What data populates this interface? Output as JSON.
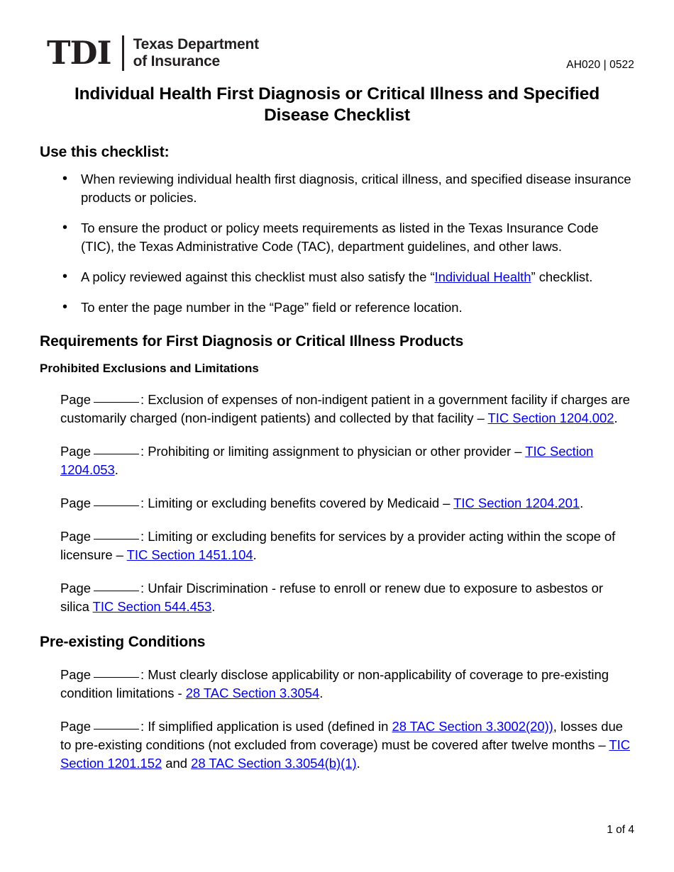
{
  "header": {
    "logo_mark": "TDI",
    "logo_line1": "Texas Department",
    "logo_line2": "of Insurance",
    "doc_id": "AH020 | 0522"
  },
  "title": "Individual Health First Diagnosis or Critical Illness and Specified Disease Checklist",
  "use_section": {
    "heading": "Use this checklist:",
    "bullets": [
      {
        "pre": "When reviewing individual health first diagnosis, critical illness, and specified disease insurance products or policies.",
        "link": "",
        "post": ""
      },
      {
        "pre": "To ensure the product or policy meets requirements as listed in the Texas Insurance Code (TIC), the Texas Administrative Code (TAC), department guidelines, and other laws.",
        "link": "",
        "post": ""
      },
      {
        "pre": "A policy reviewed against this checklist must also satisfy the “",
        "link": "Individual Health",
        "post": "” checklist."
      },
      {
        "pre": "To enter the page number in the “Page” field or reference location.",
        "link": "",
        "post": ""
      }
    ]
  },
  "requirements_section": {
    "heading": "Requirements for First Diagnosis or Critical Illness Products",
    "subheading": "Prohibited Exclusions and Limitations",
    "page_label": "Page",
    "items": [
      {
        "text_before": ": Exclusion of expenses of non-indigent patient in a government facility if charges are  customarily charged (non-indigent patients) and collected by that facility – ",
        "link1": "TIC Section 1204.002",
        "text_mid": "",
        "link2": "",
        "text_after": "."
      },
      {
        "text_before": ": Prohibiting or limiting assignment to physician or other provider – ",
        "link1": "TIC Section 1204.053",
        "text_mid": "",
        "link2": "",
        "text_after": "."
      },
      {
        "text_before": ": Limiting or excluding benefits covered by Medicaid – ",
        "link1": "TIC Section 1204.201",
        "text_mid": "",
        "link2": "",
        "text_after": "."
      },
      {
        "text_before": ": Limiting or excluding benefits for services by a provider acting within the scope of licensure – ",
        "link1": "TIC Section 1451.104",
        "text_mid": "",
        "link2": "",
        "text_after": "."
      },
      {
        "text_before": ": Unfair Discrimination - refuse to enroll or renew due to exposure to asbestos or silica ",
        "link1": "TIC Section 544.453",
        "text_mid": "",
        "link2": "",
        "text_after": "."
      }
    ]
  },
  "preexisting_section": {
    "heading": "Pre-existing Conditions",
    "page_label": "Page",
    "items": [
      {
        "text_before": ": Must clearly disclose applicability or non-applicability of coverage to pre-existing condition limitations - ",
        "link1": "28 TAC Section 3.3054",
        "text_mid": "",
        "link2": "",
        "text_after": "."
      },
      {
        "text_before": ": If simplified application is used (defined in ",
        "link1": "28 TAC Section 3.3002(20))",
        "text_mid": ", losses due to pre-existing conditions (not excluded from coverage) must be covered after twelve months – ",
        "link2": "TIC Section 1201.152",
        "text_after": ""
      }
    ],
    "tail": {
      "join_word": " and ",
      "link3": "28 TAC Section 3.3054(b)(1)",
      "period": "."
    }
  },
  "footer": {
    "page_number": "1 of 4"
  },
  "colors": {
    "link": "#0000ee",
    "text": "#000000",
    "logo": "#231f20"
  }
}
